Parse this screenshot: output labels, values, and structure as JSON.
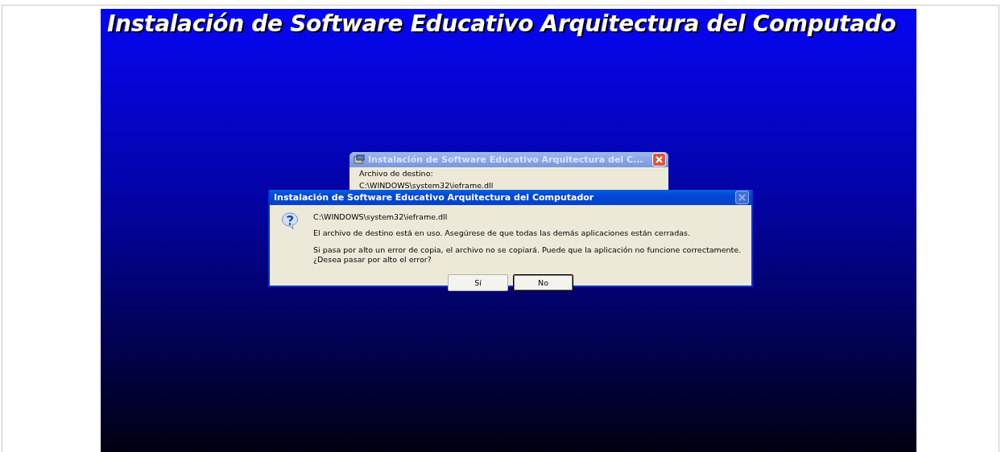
{
  "page_title": "Instalación de Software Educativo Arquitectura del Computado",
  "back_window": {
    "title": "Instalación de Software Educativo Arquitectura del C...",
    "label": "Archivo de destino:",
    "path": "C:\\WINDOWS\\system32\\ieframe.dll",
    "close_disabled": false
  },
  "dialog": {
    "title": "Instalación de Software Educativo Arquitectura del Computador",
    "close_disabled": true,
    "messages": [
      "C:\\WINDOWS\\system32\\ieframe.dll",
      "El archivo de destino está en uso. Asegúrese de que todas las demás aplicaciones están cerradas.",
      "Si pasa por alto un error de copia, el archivo no se copiará. Puede que la aplicación no funcione correctamente.\n¿Desea pasar por alto el error?"
    ],
    "buttons": [
      {
        "label": "Sí",
        "selected": false
      },
      {
        "label": "No",
        "selected": true
      }
    ]
  }
}
